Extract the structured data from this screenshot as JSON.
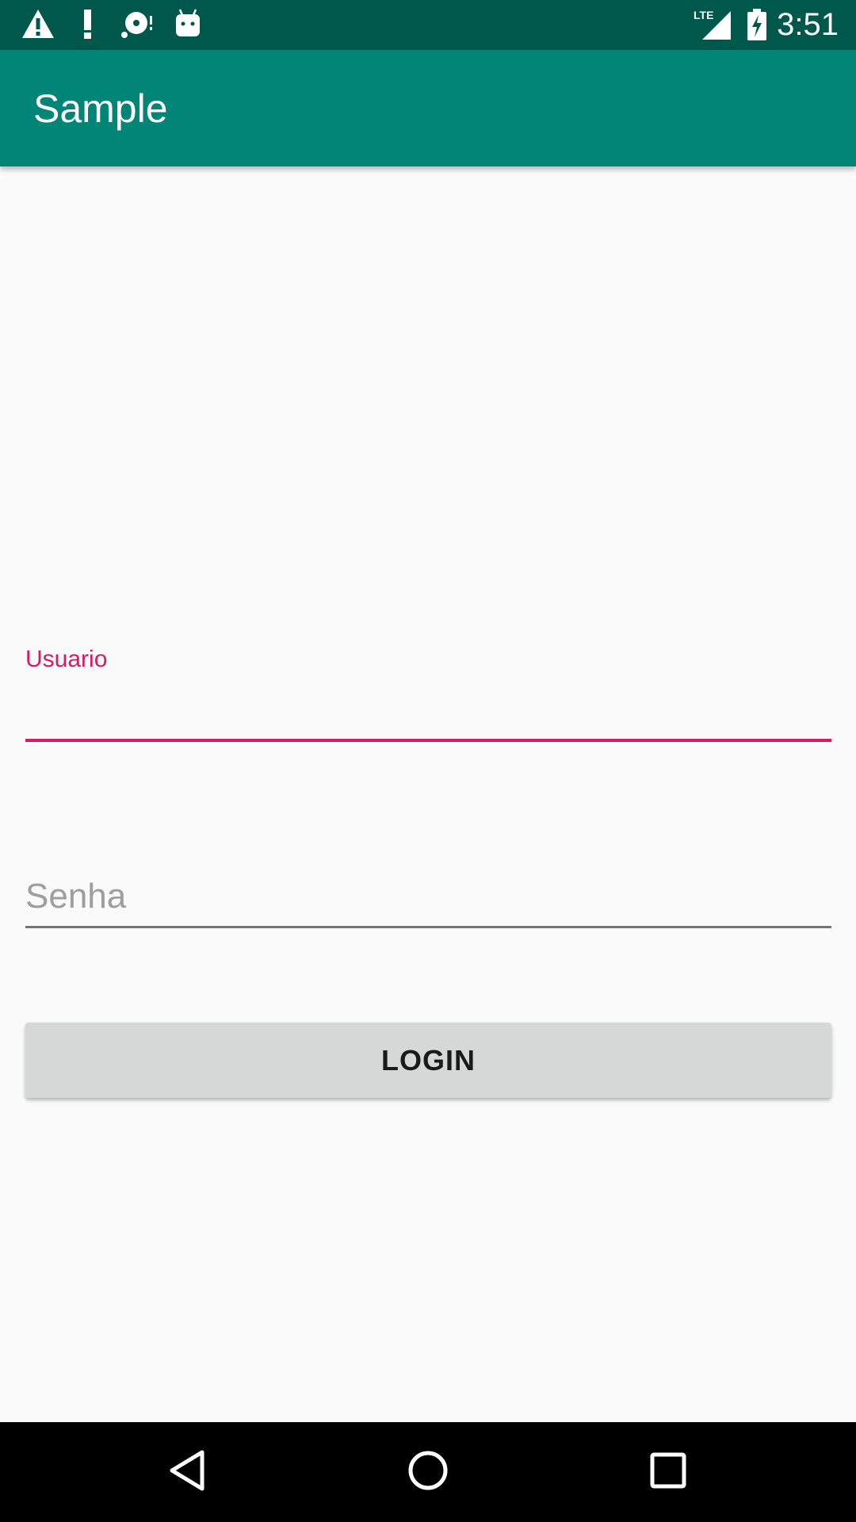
{
  "status_bar": {
    "time": "3:51",
    "network_label": "LTE",
    "icons": [
      "warning-icon",
      "exclamation-icon",
      "sync-disc-icon",
      "android-icon",
      "lte-signal-icon",
      "battery-charging-icon"
    ]
  },
  "app_bar": {
    "title": "Sample"
  },
  "form": {
    "username": {
      "label": "Usuario",
      "value": ""
    },
    "password": {
      "placeholder": "Senha",
      "value": ""
    },
    "login_label": "LOGIN"
  },
  "nav_bar": {
    "icons": [
      "back-icon",
      "home-icon",
      "recents-icon"
    ]
  },
  "colors": {
    "status_bar": "#00574b",
    "app_bar": "#008577",
    "accent": "#d81b60",
    "background": "#fafafa",
    "button": "#d6d7d7"
  }
}
